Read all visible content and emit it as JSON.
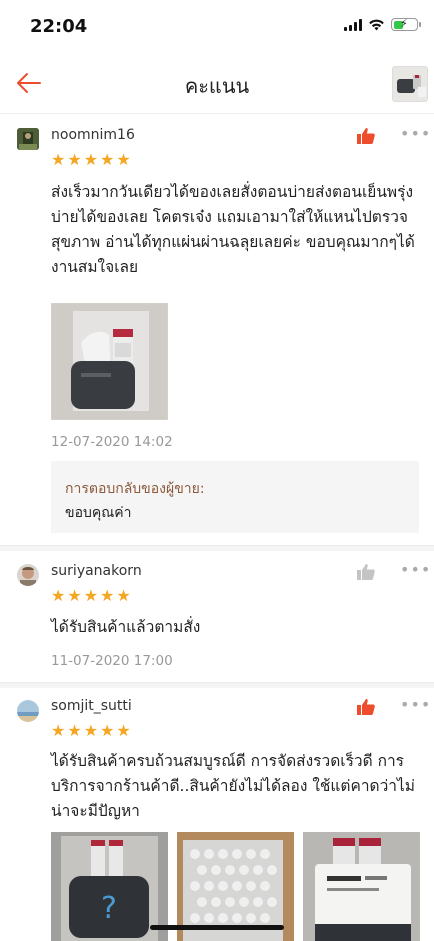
{
  "status_bar": {
    "time": "22:04"
  },
  "nav": {
    "title": "คะแนน"
  },
  "reviews": [
    {
      "username": "noomnim16",
      "stars": 5,
      "liked": true,
      "text": "ส่งเร็วมากวันเดียวได้ของเลยสั่งตอนบ่ายส่งตอนเย็นพรุ่งบ่ายได้ของเลย โคตรเจ๋ง แถมเอามาใส่ให้แหนไปตรวจสุขภาพ อ่านได้ทุกแผ่นผ่านฉลุยเลยค่ะ ขอบคุณมากๆได้งานสมใจเลย",
      "date": "12-07-2020 14:02",
      "seller_reply_label": "การตอบกลับของผู้ขาย:",
      "seller_reply": "ขอบคุณค่า"
    },
    {
      "username": "suriyanakorn",
      "stars": 5,
      "liked": false,
      "text": "ได้รับสินค้าแล้วตามสั่ง",
      "date": "11-07-2020 17:00"
    },
    {
      "username": "somjit_sutti",
      "stars": 5,
      "liked": true,
      "text": "ได้รับสินค้าครบถ้วนสมบูรณ์ดี การจัดส่งรวดเร็วดี การบริการจากร้านค้าดี..สินค้ายังไม่ได้ลอง ใช้แต่คาดว่าไม่น่าจะมีปัญหา"
    }
  ],
  "icons": {
    "back": "back-arrow-icon",
    "like": "thumbs-up-icon",
    "more": "more-options-icon",
    "star": "star-icon"
  },
  "colors": {
    "accent": "#ee4d2d",
    "star": "#f5a623",
    "seller_label": "#8b5a3c",
    "muted": "#999999"
  }
}
